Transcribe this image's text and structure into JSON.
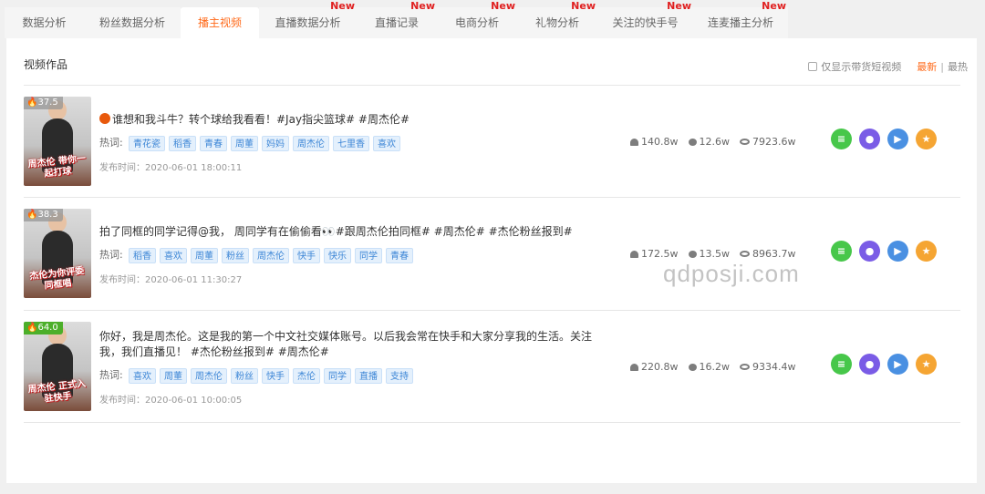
{
  "tabs": [
    {
      "label": "数据分析",
      "new": ""
    },
    {
      "label": "粉丝数据分析",
      "new": ""
    },
    {
      "label": "播主视频",
      "new": ""
    },
    {
      "label": "直播数据分析",
      "new": "New"
    },
    {
      "label": "直播记录",
      "new": "New"
    },
    {
      "label": "电商分析",
      "new": "New"
    },
    {
      "label": "礼物分析",
      "new": "New"
    },
    {
      "label": "关注的快手号",
      "new": "New"
    },
    {
      "label": "连麦播主分析",
      "new": "New"
    }
  ],
  "active_tab": "播主视频",
  "section": {
    "title": "视频作品",
    "filter_label": "仅显示带货短视频",
    "sort_latest": "最新",
    "sort_separator": "|",
    "sort_hot": "最热"
  },
  "hot_words_label": "热词:",
  "videos": [
    {
      "heat": "37.5",
      "thumb_caption": "周杰伦 带你一起打球",
      "title": "谁想和我斗牛？转个球给我看看！#Jay指尖篮球# #周杰伦#",
      "tags": [
        "青花瓷",
        "稻香",
        "青春",
        "周董",
        "妈妈",
        "周杰伦",
        "七里香",
        "喜欢"
      ],
      "date": "发布时间：2020-06-01 18:00:11",
      "likes": "140.8w",
      "comments": "12.6w",
      "views": "7923.6w"
    },
    {
      "heat": "38.3",
      "thumb_caption": "杰伦为你评委 同框唱",
      "title": "拍了同框的同学记得@我， 周同学有在偷偷看👀#跟周杰伦拍同框# #周杰伦# #杰伦粉丝报到#",
      "tags": [
        "稻香",
        "喜欢",
        "周董",
        "粉丝",
        "周杰伦",
        "快手",
        "快乐",
        "同学",
        "青春"
      ],
      "date": "发布时间：2020-06-01 11:30:27",
      "likes": "172.5w",
      "comments": "13.5w",
      "views": "8963.7w"
    },
    {
      "heat": "64.0",
      "thumb_caption": "周杰伦 正式入驻快手",
      "title": "你好，我是周杰伦。这是我的第一个中文社交媒体账号。以后我会常在快手和大家分享我的生活。关注我，我们直播见！ #杰伦粉丝报到# #周杰伦#",
      "tags": [
        "喜欢",
        "周董",
        "周杰伦",
        "粉丝",
        "快手",
        "杰伦",
        "同学",
        "直播",
        "支持"
      ],
      "date": "发布时间：2020-06-01 10:00:05",
      "likes": "220.8w",
      "comments": "16.2w",
      "views": "9334.4w"
    }
  ],
  "action_icons": [
    "list-icon",
    "fans-icon",
    "play-icon",
    "star-icon"
  ],
  "colors": {
    "accent": "#ff6a1a",
    "new_badge": "#e02020",
    "tag_text": "#3d86d6",
    "heat_green": "#4caf2a"
  },
  "watermark": "qdposji.com"
}
